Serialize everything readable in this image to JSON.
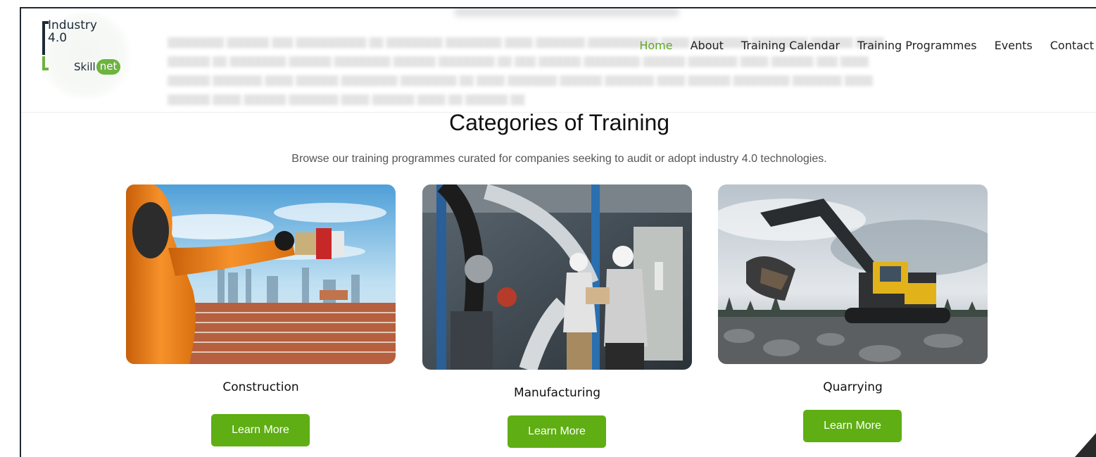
{
  "brand": {
    "line1": "Industry",
    "line2": "4.0",
    "skill": "Skill",
    "net": "net"
  },
  "nav": {
    "items": [
      {
        "label": "Home",
        "active": true
      },
      {
        "label": "About"
      },
      {
        "label": "Training Calendar"
      },
      {
        "label": "Training Programmes"
      },
      {
        "label": "Events"
      },
      {
        "label": "Contact"
      }
    ]
  },
  "main": {
    "title": "Categories of Training",
    "subtitle": "Browse our training programmes curated for  companies seeking to audit or adopt industry 4.0 technologies.",
    "cards": [
      {
        "label": "Construction",
        "button": "Learn More"
      },
      {
        "label": "Manufacturing",
        "button": "Learn More"
      },
      {
        "label": "Quarrying",
        "button": "Learn More"
      }
    ]
  },
  "colors": {
    "accent_green": "#5fae14",
    "nav_active": "#5fa82a",
    "logo_dark": "#1c2b36"
  }
}
